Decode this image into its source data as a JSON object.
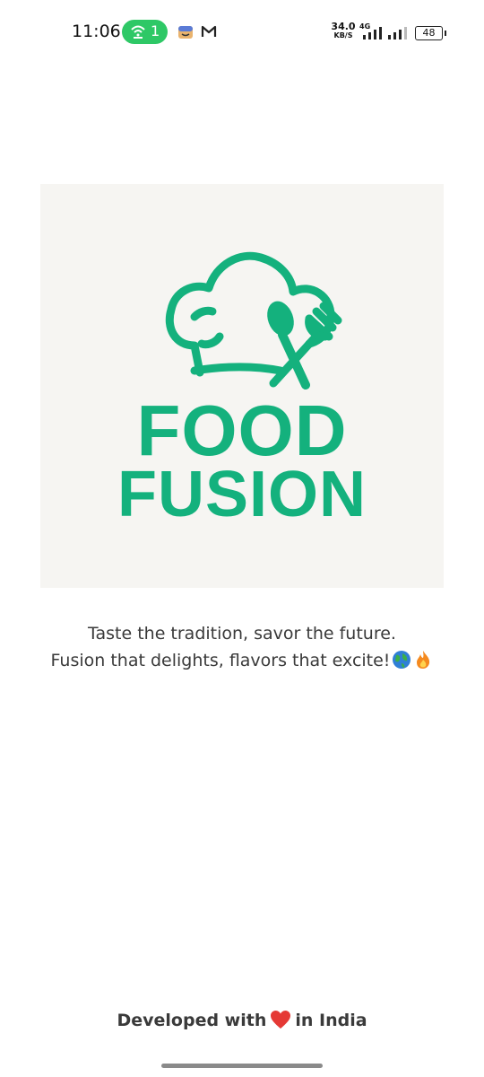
{
  "status_bar": {
    "time": "11:06",
    "hotspot_count": "1",
    "net_speed_value": "34.0",
    "net_speed_unit": "KB/S",
    "network_type": "4G",
    "battery": "48"
  },
  "logo": {
    "line1": "FOOD",
    "line2": "FUSION",
    "brand_color": "#14b17d"
  },
  "tagline": {
    "line1": "Taste the tradition, savor the future.",
    "line2": "Fusion that delights, flavors that excite!",
    "emojis": [
      "globe-icon",
      "fire-icon"
    ]
  },
  "footer": {
    "prefix": "Developed with",
    "suffix": "in India",
    "icon": "heart-icon"
  }
}
